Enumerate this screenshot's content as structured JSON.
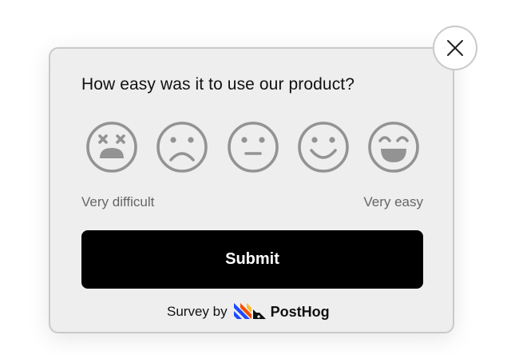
{
  "survey": {
    "question": "How easy was it to use our product?",
    "rating_options": [
      {
        "icon": "dizzy-face-icon",
        "level": 1
      },
      {
        "icon": "frowning-face-icon",
        "level": 2
      },
      {
        "icon": "neutral-face-icon",
        "level": 3
      },
      {
        "icon": "smiling-face-icon",
        "level": 4
      },
      {
        "icon": "laughing-face-icon",
        "level": 5
      }
    ],
    "scale_low_label": "Very difficult",
    "scale_high_label": "Very easy",
    "submit_label": "Submit",
    "footer_prefix": "Survey by",
    "brand_name": "PostHog",
    "close_icon": "close-icon"
  },
  "colors": {
    "card_background": "#eeeeee",
    "card_border": "#c9c9c9",
    "emoji_gray": "#939393",
    "button_background": "#000000",
    "button_text": "#ffffff",
    "label_text": "#666666",
    "logo_blue": "#1d4aff",
    "logo_orange": "#f54e00",
    "logo_yellow": "#f9bd2b"
  }
}
